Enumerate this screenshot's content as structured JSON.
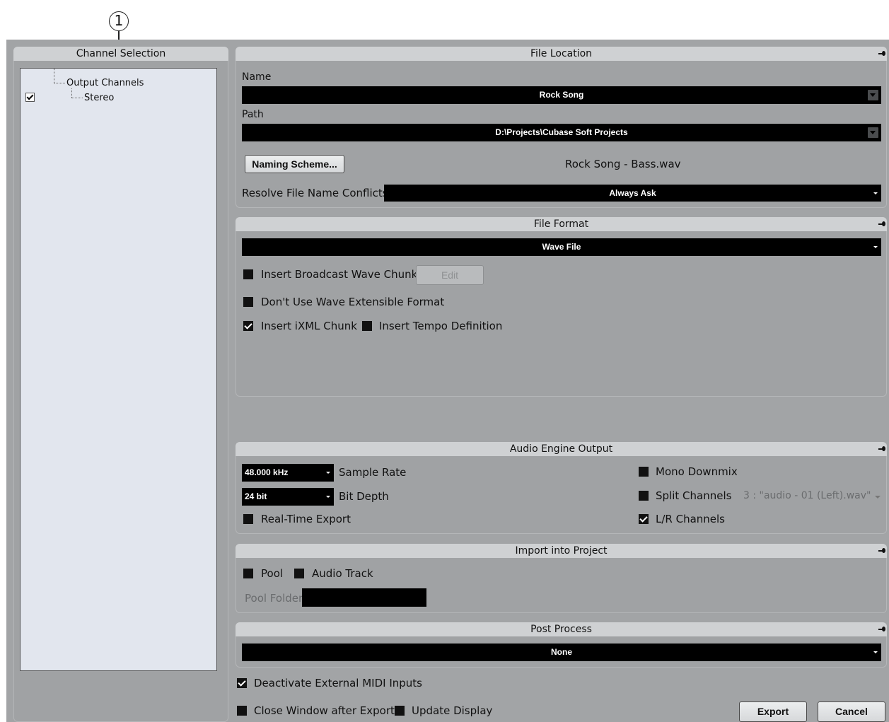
{
  "callout": {
    "number": "1"
  },
  "channel_selection": {
    "title": "Channel Selection",
    "tree": {
      "root": "Output Channels",
      "child": "Stereo",
      "child_checked": true
    }
  },
  "file_location": {
    "title": "File Location",
    "name_label": "Name",
    "name_value": "Rock Song",
    "path_label": "Path",
    "path_value": "D:\\Projects\\Cubase Soft Projects",
    "naming_button": "Naming Scheme...",
    "filename_preview": "Rock Song - Bass.wav",
    "resolve_label": "Resolve File Name Conflicts",
    "resolve_value": "Always Ask"
  },
  "file_format": {
    "title": "File Format",
    "format_value": "Wave File",
    "broadcast_label": "Insert Broadcast Wave Chunk",
    "broadcast_checked": false,
    "edit_button": "Edit",
    "wave_ext_label": "Don't Use Wave Extensible Format",
    "wave_ext_checked": false,
    "ixml_label": "Insert iXML Chunk",
    "ixml_checked": true,
    "tempo_label": "Insert Tempo Definition",
    "tempo_checked": false
  },
  "audio_engine": {
    "title": "Audio Engine Output",
    "sample_rate_value": "48.000 kHz",
    "sample_rate_label": "Sample Rate",
    "bit_depth_value": "24 bit",
    "bit_depth_label": "Bit Depth",
    "realtime_label": "Real-Time Export",
    "realtime_checked": false,
    "mono_label": "Mono Downmix",
    "mono_checked": false,
    "split_label": "Split Channels",
    "split_checked": false,
    "split_value": "3 : \"audio - 01 (Left).wav\"",
    "lr_label": "L/R Channels",
    "lr_checked": true
  },
  "import_project": {
    "title": "Import into Project",
    "pool_label": "Pool",
    "pool_checked": false,
    "audio_track_label": "Audio Track",
    "audio_track_checked": false,
    "pool_folder_label": "Pool Folder",
    "pool_folder_value": ""
  },
  "post_process": {
    "title": "Post Process",
    "value": "None"
  },
  "footer": {
    "deactivate_midi_label": "Deactivate External MIDI Inputs",
    "deactivate_midi_checked": true,
    "close_window_label": "Close Window after Export",
    "close_window_checked": false,
    "update_display_label": "Update Display",
    "update_display_checked": false,
    "export_button": "Export",
    "cancel_button": "Cancel"
  },
  "colors": {
    "dialog_bg": "#a2a4a6",
    "header_bg": "#cfd1d3",
    "field_bg": "#000000",
    "tree_bg": "#e2e6ee"
  }
}
